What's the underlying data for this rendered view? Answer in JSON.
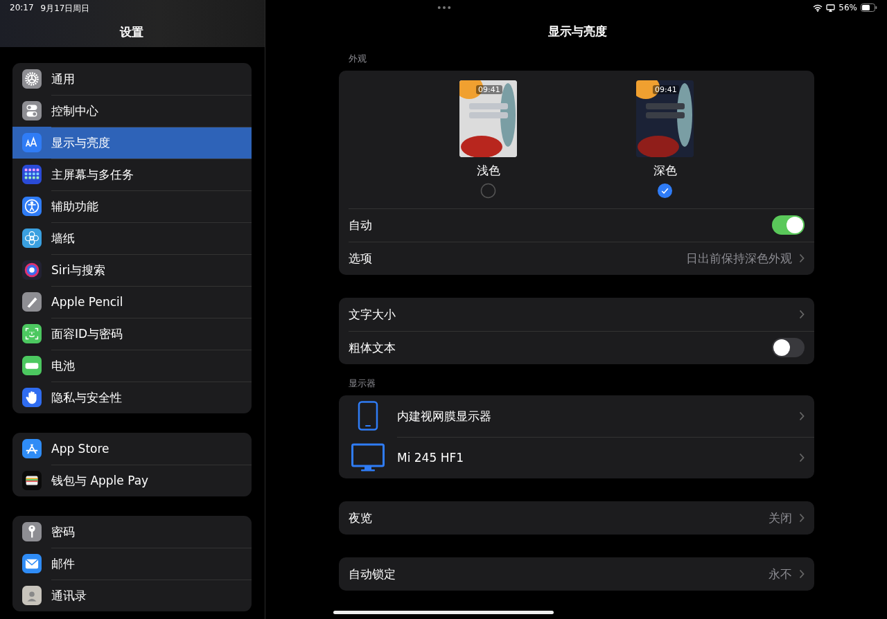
{
  "status_bar": {
    "time": "20:17",
    "date": "9月17日周日",
    "battery_text": "56%"
  },
  "sidebar": {
    "title": "设置",
    "groups": [
      {
        "items": [
          {
            "label": "通用",
            "kind": "gear",
            "color": "#8e8e93",
            "selected": false
          },
          {
            "label": "控制中心",
            "kind": "toggles",
            "color": "#8e8e93",
            "selected": false
          },
          {
            "label": "显示与亮度",
            "kind": "textsize",
            "color": "#2f7cf6",
            "selected": true
          },
          {
            "label": "主屏幕与多任务",
            "kind": "grid",
            "color": "#2a4bd7",
            "selected": false
          },
          {
            "label": "辅助功能",
            "kind": "accessibility",
            "color": "#2f7cf6",
            "selected": false
          },
          {
            "label": "墙纸",
            "kind": "flower",
            "color": "#3aa0e0",
            "selected": false
          },
          {
            "label": "Siri与搜索",
            "kind": "siri",
            "color": "#222233",
            "selected": false
          },
          {
            "label": "Apple Pencil",
            "kind": "pencil",
            "color": "#8e8e93",
            "selected": false
          },
          {
            "label": "面容ID与密码",
            "kind": "face",
            "color": "#4cc860",
            "selected": false
          },
          {
            "label": "电池",
            "kind": "battery",
            "color": "#4cc860",
            "selected": false
          },
          {
            "label": "隐私与安全性",
            "kind": "hand",
            "color": "#2f6cf0",
            "selected": false
          }
        ]
      },
      {
        "items": [
          {
            "label": "App Store",
            "kind": "appstore",
            "color": "#2f8cf6",
            "selected": false
          },
          {
            "label": "钱包与 Apple Pay",
            "kind": "wallet",
            "color": "#0a0a0a",
            "selected": false
          }
        ]
      },
      {
        "items": [
          {
            "label": "密码",
            "kind": "key",
            "color": "#8e8e93",
            "selected": false
          },
          {
            "label": "邮件",
            "kind": "mail",
            "color": "#2f8cf6",
            "selected": false
          },
          {
            "label": "通讯录",
            "kind": "contacts",
            "color": "#c8c4bc",
            "selected": false
          }
        ]
      }
    ]
  },
  "detail": {
    "title": "显示与亮度",
    "sections": [
      {
        "header": "外观",
        "appearance": [
          {
            "label": "浅色",
            "time": "09:41",
            "kind": "light",
            "selected": false
          },
          {
            "label": "深色",
            "time": "09:41",
            "kind": "dark",
            "selected": true
          }
        ],
        "rows": [
          {
            "kind": "toggle",
            "label": "自动",
            "on": true
          },
          {
            "kind": "link",
            "label": "选项",
            "value": "日出前保持深色外观"
          }
        ]
      },
      {
        "rows": [
          {
            "kind": "link",
            "label": "文字大小"
          },
          {
            "kind": "toggle",
            "label": "粗体文本",
            "on": false
          }
        ]
      },
      {
        "header": "显示器",
        "rows": [
          {
            "kind": "tablet",
            "label": "内建视网膜显示器"
          },
          {
            "kind": "monitor",
            "label": "Mi 245 HF1"
          }
        ]
      },
      {
        "rows": [
          {
            "kind": "link",
            "label": "夜览",
            "value": "关闭"
          }
        ]
      },
      {
        "rows": [
          {
            "kind": "link",
            "label": "自动锁定",
            "value": "永不"
          }
        ]
      }
    ]
  }
}
